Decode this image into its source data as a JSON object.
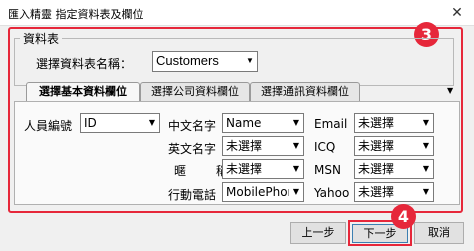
{
  "window": {
    "title": "匯入精靈 指定資料表及欄位"
  },
  "annotations": {
    "badge_3": "3",
    "badge_4": "4"
  },
  "group": {
    "legend": "資料表",
    "table_label": "選擇資料表名稱：",
    "table_value": "Customers"
  },
  "tabs": [
    {
      "label": "選擇基本資料欄位",
      "active": true
    },
    {
      "label": "選擇公司資料欄位",
      "active": false
    },
    {
      "label": "選擇通訊資料欄位",
      "active": false
    }
  ],
  "fields": {
    "id_label": "人員編號",
    "id_value": "ID",
    "cname_label": "中文名字",
    "cname_value": "Name",
    "ename_label": "英文名字",
    "ename_value": "未選擇",
    "title_label": "暱　稱",
    "title_value": "未選擇",
    "mobile_label": "行動電話",
    "mobile_value": "MobilePhone",
    "email_label": "Email",
    "email_value": "未選擇",
    "icq_label": "ICQ",
    "icq_value": "未選擇",
    "msn_label": "MSN",
    "msn_value": "未選擇",
    "yahoo_label": "Yahoo",
    "yahoo_value": "未選擇"
  },
  "buttons": {
    "prev": "上一步",
    "next": "下一步",
    "cancel": "取消"
  },
  "colors": {
    "highlight": "#e6273a",
    "focus": "#3c7fb1"
  }
}
